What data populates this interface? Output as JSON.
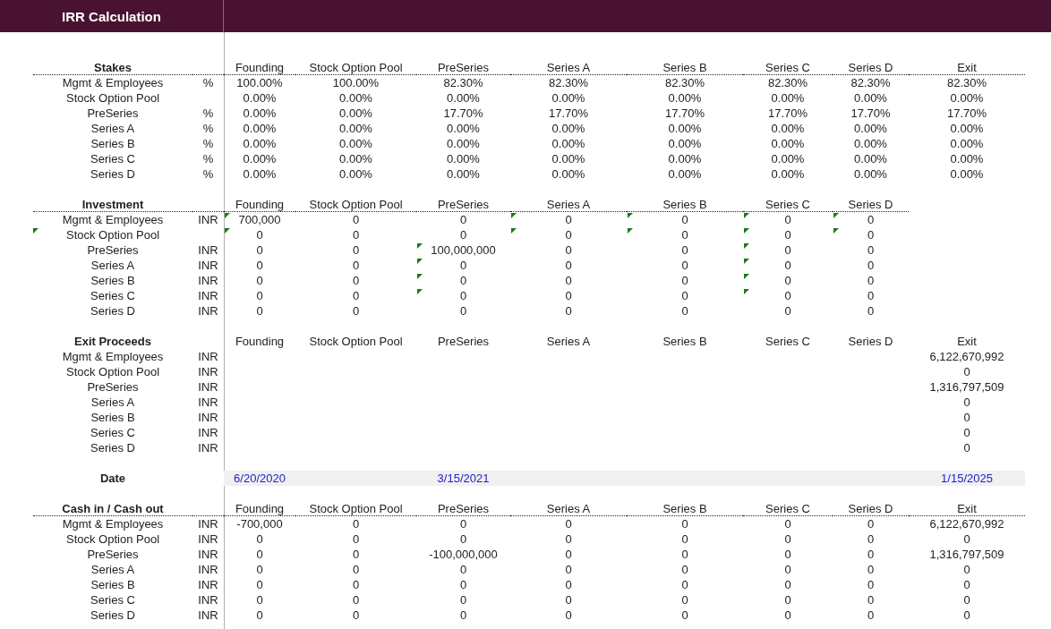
{
  "title": "IRR Calculation",
  "sections": [
    {
      "kind": "table",
      "title": "Stakes",
      "header_rule": true,
      "columns": [
        "Founding",
        "Stock Option Pool",
        "PreSeries",
        "Series A",
        "Series B",
        "Series C",
        "Series D",
        "Exit"
      ],
      "rows": [
        {
          "label": "Mgmt & Employees",
          "unit": "%",
          "cells": [
            "100.00%",
            "100.00%",
            "82.30%",
            "82.30%",
            "82.30%",
            "82.30%",
            "82.30%",
            "82.30%"
          ]
        },
        {
          "label": "Stock Option Pool",
          "cells": [
            "0.00%",
            "0.00%",
            "0.00%",
            "0.00%",
            "0.00%",
            "0.00%",
            "0.00%",
            "0.00%"
          ]
        },
        {
          "label": "PreSeries",
          "unit": "%",
          "cells": [
            "0.00%",
            "0.00%",
            "17.70%",
            "17.70%",
            "17.70%",
            "17.70%",
            "17.70%",
            "17.70%"
          ]
        },
        {
          "label": "Series A",
          "unit": "%",
          "cells": [
            "0.00%",
            "0.00%",
            "0.00%",
            "0.00%",
            "0.00%",
            "0.00%",
            "0.00%",
            "0.00%"
          ]
        },
        {
          "label": "Series B",
          "unit": "%",
          "cells": [
            "0.00%",
            "0.00%",
            "0.00%",
            "0.00%",
            "0.00%",
            "0.00%",
            "0.00%",
            "0.00%"
          ]
        },
        {
          "label": "Series C",
          "unit": "%",
          "cells": [
            "0.00%",
            "0.00%",
            "0.00%",
            "0.00%",
            "0.00%",
            "0.00%",
            "0.00%",
            "0.00%"
          ]
        },
        {
          "label": "Series D",
          "unit": "%",
          "cells": [
            "0.00%",
            "0.00%",
            "0.00%",
            "0.00%",
            "0.00%",
            "0.00%",
            "0.00%",
            "0.00%"
          ]
        }
      ]
    },
    {
      "kind": "table",
      "title": "Investment",
      "header_rule": true,
      "columns": [
        "Founding",
        "Stock Option Pool",
        "PreSeries",
        "Series A",
        "Series B",
        "Series C",
        "Series D"
      ],
      "rows": [
        {
          "label": "Mgmt & Employees",
          "unit": "INR",
          "label_flagged": false,
          "cells": [
            "700,000",
            "0",
            "0",
            "0",
            "0",
            "0",
            "0"
          ],
          "flags": [
            true,
            false,
            false,
            true,
            true,
            true,
            true
          ]
        },
        {
          "label": "Stock Option Pool",
          "label_flagged": true,
          "cells": [
            "0",
            "0",
            "0",
            "0",
            "0",
            "0",
            "0"
          ],
          "flags": [
            true,
            false,
            false,
            true,
            true,
            true,
            true
          ]
        },
        {
          "label": "PreSeries",
          "unit": "INR",
          "label_flagged": false,
          "cells": [
            "0",
            "0",
            "100,000,000",
            "0",
            "0",
            "0",
            "0"
          ],
          "flags": [
            false,
            false,
            true,
            false,
            false,
            true,
            false
          ]
        },
        {
          "label": "Series A",
          "unit": "INR",
          "label_flagged": false,
          "cells": [
            "0",
            "0",
            "0",
            "0",
            "0",
            "0",
            "0"
          ],
          "flags": [
            false,
            false,
            true,
            false,
            false,
            true,
            false
          ]
        },
        {
          "label": "Series B",
          "unit": "INR",
          "label_flagged": false,
          "cells": [
            "0",
            "0",
            "0",
            "0",
            "0",
            "0",
            "0"
          ],
          "flags": [
            false,
            false,
            true,
            false,
            false,
            true,
            false
          ]
        },
        {
          "label": "Series C",
          "unit": "INR",
          "label_flagged": false,
          "cells": [
            "0",
            "0",
            "0",
            "0",
            "0",
            "0",
            "0"
          ],
          "flags": [
            false,
            false,
            true,
            false,
            false,
            true,
            false
          ]
        },
        {
          "label": "Series D",
          "unit": "INR",
          "label_flagged": false,
          "cells": [
            "0",
            "0",
            "0",
            "0",
            "0",
            "0",
            "0"
          ],
          "flags": [
            false,
            false,
            false,
            false,
            false,
            false,
            false
          ]
        }
      ]
    },
    {
      "kind": "table",
      "title": "Exit Proceeds",
      "header_rule": false,
      "columns": [
        "Founding",
        "Stock Option Pool",
        "PreSeries",
        "Series A",
        "Series B",
        "Series C",
        "Series D",
        "Exit"
      ],
      "rows": [
        {
          "label": "Mgmt & Employees",
          "unit": "INR",
          "cells": [
            null,
            null,
            null,
            null,
            null,
            null,
            null,
            "6,122,670,992"
          ]
        },
        {
          "label": "Stock Option Pool",
          "unit": "INR",
          "cells": [
            null,
            null,
            null,
            null,
            null,
            null,
            null,
            "0"
          ]
        },
        {
          "label": "PreSeries",
          "unit": "INR",
          "cells": [
            null,
            null,
            null,
            null,
            null,
            null,
            null,
            "1,316,797,509"
          ]
        },
        {
          "label": "Series A",
          "unit": "INR",
          "cells": [
            null,
            null,
            null,
            null,
            null,
            null,
            null,
            "0"
          ]
        },
        {
          "label": "Series B",
          "unit": "INR",
          "cells": [
            null,
            null,
            null,
            null,
            null,
            null,
            null,
            "0"
          ]
        },
        {
          "label": "Series C",
          "unit": "INR",
          "cells": [
            null,
            null,
            null,
            null,
            null,
            null,
            null,
            "0"
          ]
        },
        {
          "label": "Series D",
          "unit": "INR",
          "cells": [
            null,
            null,
            null,
            null,
            null,
            null,
            null,
            "0"
          ]
        }
      ]
    },
    {
      "kind": "dates",
      "title": "Date",
      "cells": [
        "6/20/2020",
        null,
        "3/15/2021",
        null,
        null,
        null,
        null,
        "1/15/2025"
      ]
    },
    {
      "kind": "table",
      "title": "Cash in / Cash out",
      "header_rule": true,
      "columns": [
        "Founding",
        "Stock Option Pool",
        "PreSeries",
        "Series A",
        "Series B",
        "Series C",
        "Series D",
        "Exit"
      ],
      "rows": [
        {
          "label": "Mgmt & Employees",
          "unit": "INR",
          "cells": [
            "-700,000",
            "0",
            "0",
            "0",
            "0",
            "0",
            "0",
            "6,122,670,992"
          ]
        },
        {
          "label": "Stock Option Pool",
          "unit": "INR",
          "cells": [
            "0",
            "0",
            "0",
            "0",
            "0",
            "0",
            "0",
            "0"
          ]
        },
        {
          "label": "PreSeries",
          "unit": "INR",
          "cells": [
            "0",
            "0",
            "-100,000,000",
            "0",
            "0",
            "0",
            "0",
            "1,316,797,509"
          ]
        },
        {
          "label": "Series A",
          "unit": "INR",
          "cells": [
            "0",
            "0",
            "0",
            "0",
            "0",
            "0",
            "0",
            "0"
          ]
        },
        {
          "label": "Series B",
          "unit": "INR",
          "cells": [
            "0",
            "0",
            "0",
            "0",
            "0",
            "0",
            "0",
            "0"
          ]
        },
        {
          "label": "Series C",
          "unit": "INR",
          "cells": [
            "0",
            "0",
            "0",
            "0",
            "0",
            "0",
            "0",
            "0"
          ]
        },
        {
          "label": "Series D",
          "unit": "INR",
          "cells": [
            "0",
            "0",
            "0",
            "0",
            "0",
            "0",
            "0",
            "0"
          ]
        }
      ]
    }
  ]
}
